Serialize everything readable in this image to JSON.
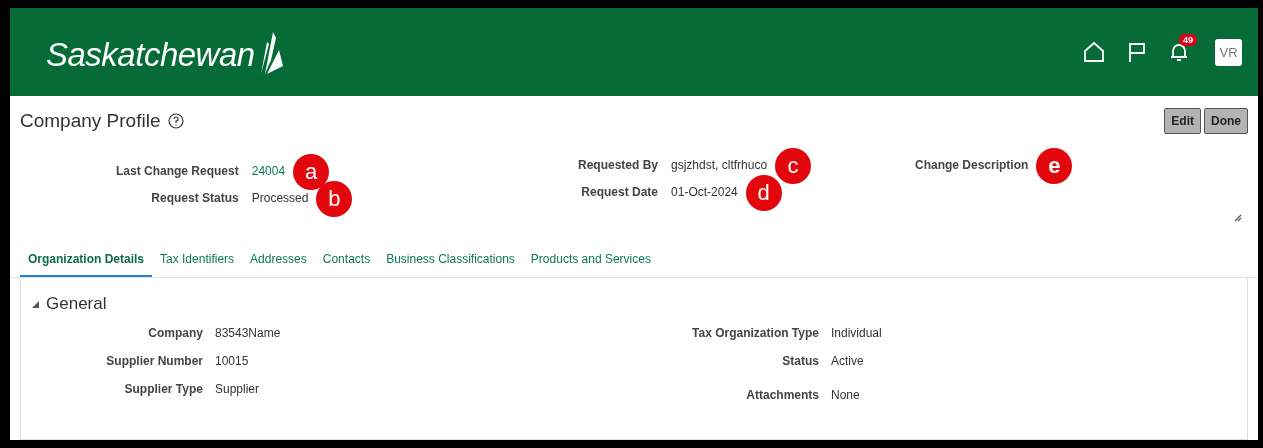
{
  "header": {
    "logo": "Saskatchewan",
    "notifications": "49",
    "avatar": "VR"
  },
  "page": {
    "title": "Company Profile",
    "buttons": [
      "Edit",
      "Done"
    ]
  },
  "request_fields": [
    {
      "label": "Last Change Request",
      "value": "24004",
      "kind": "link",
      "callout": "a"
    },
    {
      "label": "Request Status",
      "value": "Processed",
      "kind": "text",
      "callout": "b"
    },
    {
      "label": "Requested By",
      "value": "gsjzhdst, cltfrhuco",
      "kind": "text",
      "callout": "c"
    },
    {
      "label": "Request Date",
      "value": "01-Oct-2024",
      "kind": "text",
      "callout": "d"
    }
  ],
  "change_description": {
    "label": "Change Description",
    "callout": "e"
  },
  "tabs": [
    {
      "label": "Organization Details",
      "selected": true
    },
    {
      "label": "Tax Identifiers",
      "selected": false
    },
    {
      "label": "Addresses",
      "selected": false
    },
    {
      "label": "Contacts",
      "selected": false
    },
    {
      "label": "Business Classifications",
      "selected": false
    },
    {
      "label": "Products and Services",
      "selected": false
    }
  ],
  "section": {
    "title": "General",
    "expanded": true,
    "left": [
      {
        "label": "Company",
        "value": "83543Name"
      },
      {
        "label": "Supplier Number",
        "value": "10015"
      },
      {
        "label": "Supplier Type",
        "value": "Supplier"
      }
    ],
    "right": [
      {
        "label": "Tax Organization Type",
        "value": "Individual"
      },
      {
        "label": "Status",
        "value": "Active"
      },
      {
        "label": "Attachments",
        "value": "None"
      }
    ]
  }
}
